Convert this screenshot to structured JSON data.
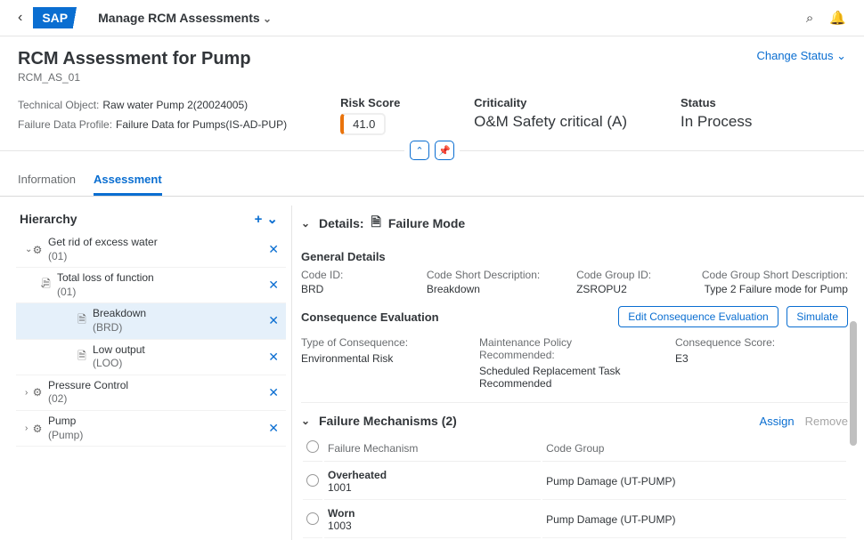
{
  "topbar": {
    "app_title": "Manage RCM Assessments",
    "logo": "SAP"
  },
  "header": {
    "title": "RCM Assessment for Pump",
    "id": "RCM_AS_01",
    "change_status": "Change Status"
  },
  "meta": {
    "tech_obj_label": "Technical Object:",
    "tech_obj_value": "Raw water Pump 2(20024005)",
    "fdp_label": "Failure Data Profile:",
    "fdp_value": "Failure Data for Pumps(IS-AD-PUP)",
    "risk_label": "Risk Score",
    "risk_value": "41.0",
    "crit_label": "Criticality",
    "crit_value": "O&M Safety critical (A)",
    "status_label": "Status",
    "status_value": "In Process"
  },
  "tabs": {
    "t0": "Information",
    "t1": "Assessment"
  },
  "hierarchy": {
    "title": "Hierarchy",
    "n0": {
      "name": "Get rid of excess water",
      "sub": "(01)"
    },
    "n1": {
      "name": "Total loss of function",
      "sub": "(01)"
    },
    "n2": {
      "name": "Breakdown",
      "sub": "(BRD)"
    },
    "n3": {
      "name": "Low output",
      "sub": "(LOO)"
    },
    "n4": {
      "name": "Pressure Control",
      "sub": "(02)"
    },
    "n5": {
      "name": "Pump",
      "sub": "(Pump)"
    }
  },
  "details": {
    "title_prefix": "Details:",
    "title_value": "Failure Mode",
    "general_head": "General Details",
    "code_id_l": "Code ID:",
    "code_id_v": "BRD",
    "code_sd_l": "Code Short Description:",
    "code_sd_v": "Breakdown",
    "code_grp_l": "Code Group ID:",
    "code_grp_v": "ZSROPU2",
    "code_grp_sd_l": "Code Group Short Description:",
    "code_grp_sd_v": "Type 2 Failure mode for Pump",
    "conseq_head": "Consequence Evaluation",
    "btn_edit": "Edit Consequence Evaluation",
    "btn_sim": "Simulate",
    "toc_l": "Type of Consequence:",
    "toc_v": "Environmental Risk",
    "mpr_l": "Maintenance Policy Recommended:",
    "mpr_v": "Scheduled Replacement Task Recommended",
    "cs_l": "Consequence Score:",
    "cs_v": "E3"
  },
  "mech": {
    "title": "Failure Mechanisms (2)",
    "assign": "Assign",
    "remove": "Remove",
    "col1": "Failure Mechanism",
    "col2": "Code Group",
    "r0": {
      "name": "Overheated",
      "code": "1001",
      "grp": "Pump Damage (UT-PUMP)"
    },
    "r1": {
      "name": "Worn",
      "code": "1003",
      "grp": "Pump Damage (UT-PUMP)"
    }
  }
}
